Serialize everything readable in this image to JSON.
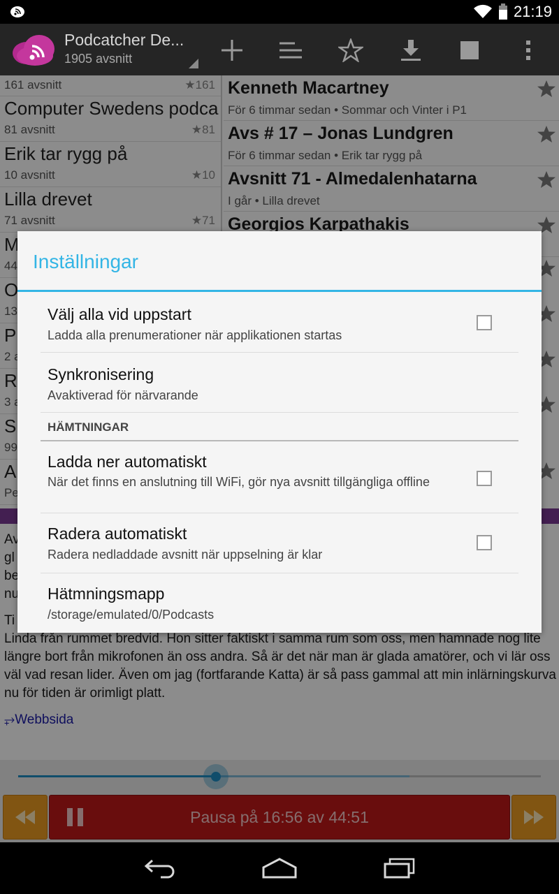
{
  "status_bar": {
    "time": "21:19",
    "icons": [
      "cast-icon",
      "wifi-icon",
      "battery-icon"
    ]
  },
  "action_bar": {
    "title": "Podcatcher De...",
    "subtitle": "1905 avsnitt",
    "icons": [
      "add-icon",
      "sort-icon",
      "star-icon",
      "download-icon",
      "stop-icon",
      "overflow-menu-icon"
    ]
  },
  "left_list": [
    {
      "title": "",
      "subtitle": "161 avsnitt",
      "count": "★161"
    },
    {
      "title": "Computer Swedens podca",
      "subtitle": "81 avsnitt",
      "count": "★81"
    },
    {
      "title": "Erik tar rygg på",
      "subtitle": "10 avsnitt",
      "count": "★10"
    },
    {
      "title": "Lilla drevet",
      "subtitle": "71 avsnitt",
      "count": "★71"
    },
    {
      "title": "M",
      "subtitle": "44",
      "count": ""
    },
    {
      "title": "O",
      "subtitle": "13",
      "count": ""
    },
    {
      "title": "P",
      "subtitle": "2 a",
      "count": ""
    },
    {
      "title": "R",
      "subtitle": "3 a",
      "count": ""
    },
    {
      "title": "S",
      "subtitle": "99",
      "count": ""
    },
    {
      "title": "A",
      "subtitle": "Pe",
      "count": ""
    }
  ],
  "right_list": [
    {
      "title": "Kenneth Macartney",
      "subtitle": "För 6 timmar sedan • Sommar och Vinter i P1"
    },
    {
      "title": "Avs # 17 – Jonas Lundgren",
      "subtitle": "För 6 timmar sedan • Erik tar rygg på"
    },
    {
      "title": "Avsnitt 71 - Almedalenhatarna",
      "subtitle": "I går • Lilla drevet"
    },
    {
      "title": "Georgios Karpathakis",
      "subtitle": ""
    }
  ],
  "description": {
    "fragments": [
      "Av",
      "gl",
      "be",
      "nu",
      "Ti"
    ],
    "text": "Linda från rummet bredvid. Hon sitter faktiskt i samma rum som oss, men hamnade nog lite längre bort från mikrofonen än oss andra. Så är det när man är glada amatörer, och vi lär oss väl vad resan lider. Även om jag (fortfarande Katta) är så pass gammal att min inlärningskurva nu för tiden är orimligt platt.",
    "link": "⥅Webbsida"
  },
  "player": {
    "pause_label": "Pausa på 16:56 av 44:51",
    "progress": 0.378,
    "buffered": 0.749
  },
  "dialog": {
    "title": "Inställningar",
    "prefs": [
      {
        "title": "Välj alla vid uppstart",
        "summary": "Ladda alla prenumerationer när applikationen startas",
        "checked": false
      },
      {
        "title": "Synkronisering",
        "summary": "Avaktiverad för närvarande"
      },
      {
        "category": "HÄMTNINGAR"
      },
      {
        "title": "Ladda ner automatiskt",
        "summary": "När det finns en anslutning till WiFi, gör nya avsnitt tillgängliga offline",
        "checked": false
      },
      {
        "title": "Radera automatiskt",
        "summary": "Radera nedladdade avsnitt när uppselning är klar",
        "checked": false
      },
      {
        "title": "Hätmningsmapp",
        "summary": "/storage/emulated/0/Podcasts"
      }
    ]
  },
  "colors": {
    "accent": "#33b5e5",
    "player_red": "#c01818",
    "player_orange": "#ec9b22",
    "purple": "#7b3a94",
    "actionbar": "#252525"
  }
}
